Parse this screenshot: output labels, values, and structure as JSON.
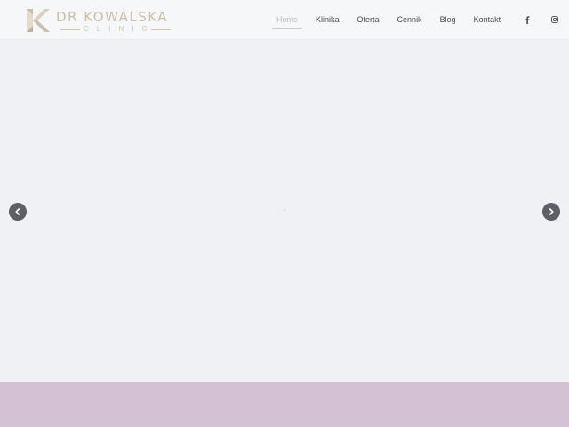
{
  "brand": {
    "name": "DR KOWALSKA",
    "subtitle": "CLINIC",
    "logo_color": "#cbbfa8"
  },
  "nav": {
    "items": [
      {
        "label": "Home",
        "active": true
      },
      {
        "label": "Klinika",
        "active": false
      },
      {
        "label": "Oferta",
        "active": false
      },
      {
        "label": "Cennik",
        "active": false
      },
      {
        "label": "Blog",
        "active": false
      },
      {
        "label": "Kontakt",
        "active": false
      }
    ]
  },
  "social": {
    "icons": [
      "facebook-icon",
      "instagram-icon"
    ]
  },
  "slider": {
    "prev_icon": "chevron-left-icon",
    "next_icon": "chevron-right-icon",
    "arrow_color": "#5e5f66"
  },
  "colors": {
    "band": "#d4c2d4",
    "background": "#f0f1f5"
  }
}
